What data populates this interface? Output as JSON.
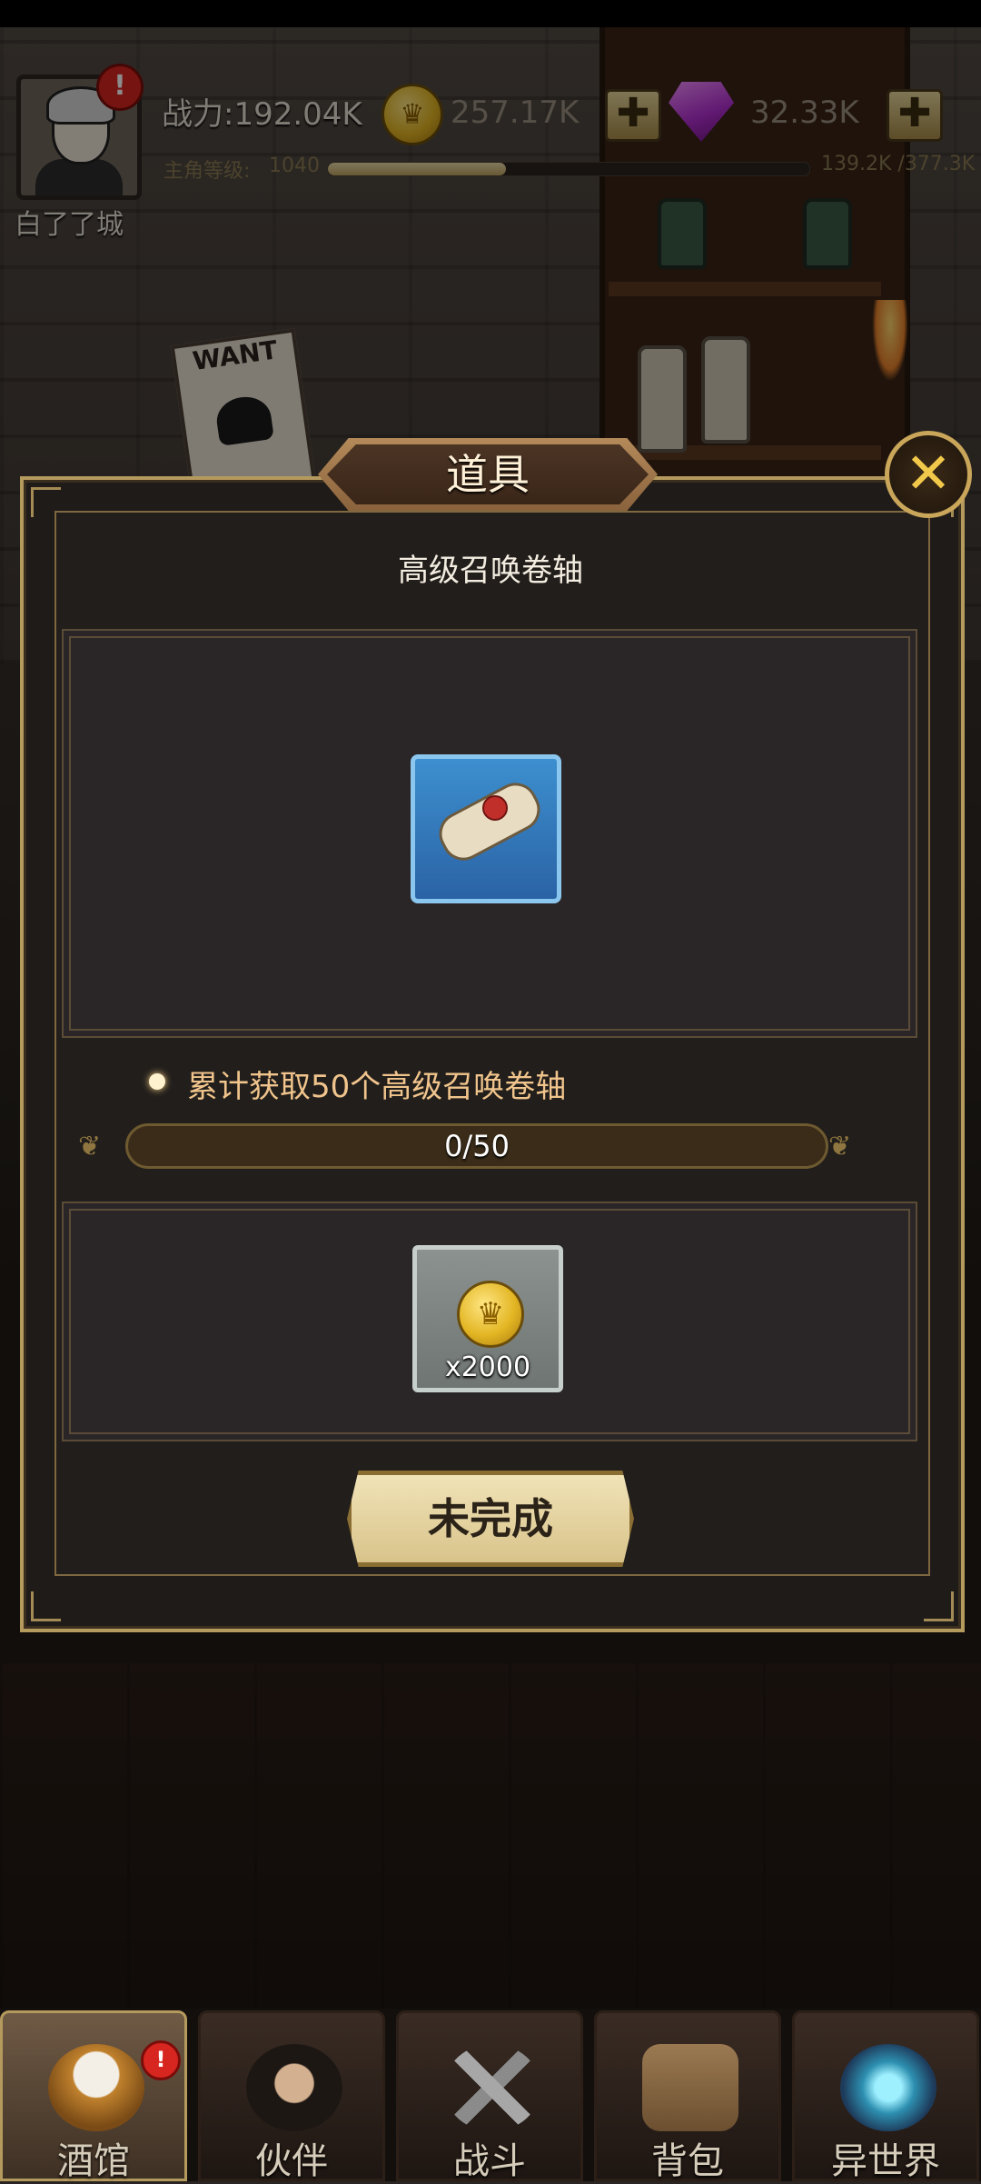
{
  "hud": {
    "player_name": "白了了城",
    "power": "战力:192.04K",
    "level_label": "主角等级:",
    "level": "1040",
    "xp_text": "139.2K /377.3K",
    "xp_fraction": 0.369,
    "gold": "257.17K",
    "gems": "32.33K",
    "plus_symbol": "✚",
    "alert_symbol": "!"
  },
  "background": {
    "poster_text": "WANT"
  },
  "modal": {
    "title": "道具",
    "close_symbol": "✕",
    "item_name": "高级召唤卷轴",
    "task_text": "累计获取50个高级召唤卷轴",
    "progress_text": "0/50",
    "progress_fraction": 0,
    "reward_count": "x2000",
    "reward_symbol": "♛",
    "status_label": "未完成"
  },
  "nav": {
    "tabs": [
      {
        "label": "酒馆",
        "icon": "beer-mug-icon",
        "active": true,
        "alert": true
      },
      {
        "label": "伙伴",
        "icon": "companion-icon",
        "active": false
      },
      {
        "label": "战斗",
        "icon": "crossed-swords-icon",
        "active": false
      },
      {
        "label": "背包",
        "icon": "backpack-icon",
        "active": false
      },
      {
        "label": "异世界",
        "icon": "portal-icon",
        "active": false
      }
    ]
  },
  "colors": {
    "accent_gold": "#b59a5e",
    "task_text": "#f0c48c",
    "item_frame_blue": "#2a63a5"
  }
}
